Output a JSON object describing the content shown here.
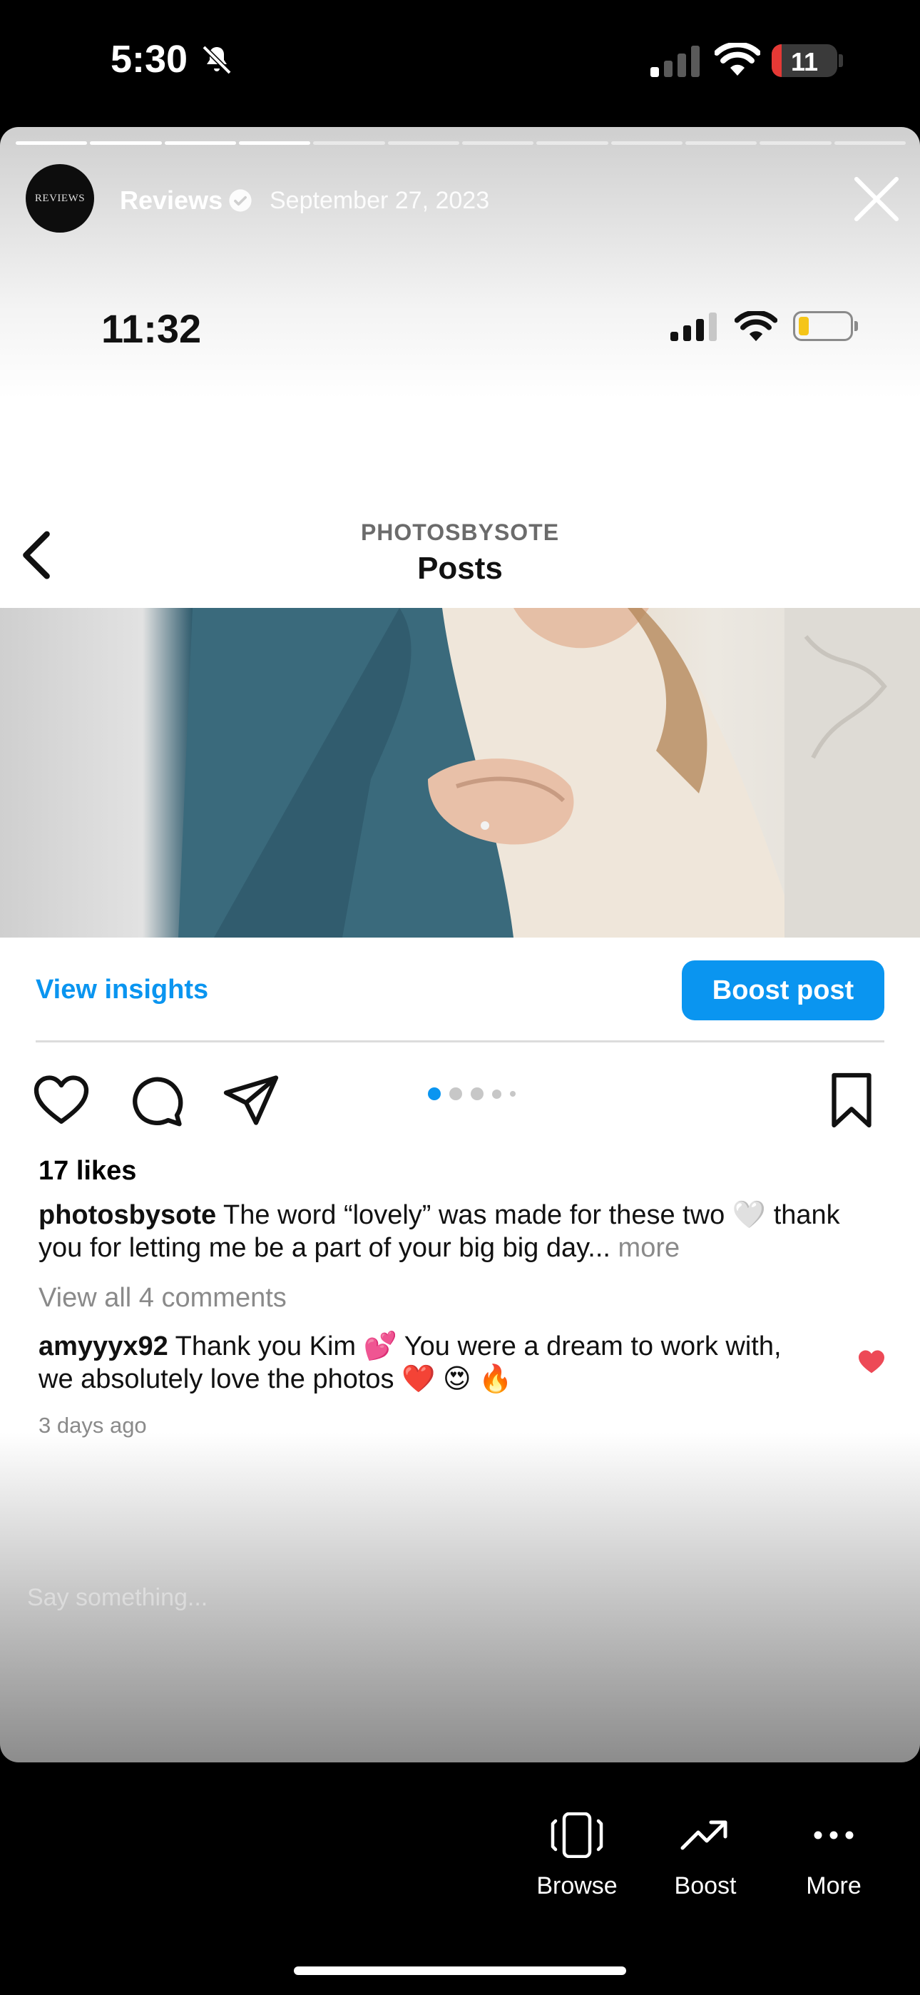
{
  "status_bar": {
    "time": "5:30",
    "battery": "11"
  },
  "story": {
    "account_name": "Reviews",
    "avatar_text": "REVIEWS",
    "date": "September 27, 2023",
    "progress_total": 12,
    "progress_done": 4
  },
  "inner": {
    "time": "11:32",
    "profile_name": "PHOTOSBYSOTE",
    "title": "Posts",
    "view_insights": "View insights",
    "boost_post": "Boost post",
    "likes": "17 likes",
    "caption_user": "photosbysote",
    "caption_text": "The word “lovely” was made for these two 🤍 thank you for letting me be a part of your big big day...",
    "caption_more": "more",
    "view_comments": "View all 4 comments",
    "comment_user": "amyyyx92",
    "comment_text": "Thank you Kim 💕 You were a dream to work with, we absolutely love the photos ❤️ 😍 🔥",
    "comment_time": "3 days ago",
    "carousel_active_index": 0
  },
  "reply_placeholder": "Say something...",
  "bottom_bar": {
    "browse": "Browse",
    "boost": "Boost",
    "more": "More"
  },
  "colors": {
    "accent": "#0a95f0",
    "heart": "#ed4956"
  },
  "icons": [
    "bell-slash-icon",
    "signal-icon",
    "wifi-icon",
    "battery-icon",
    "verified-icon",
    "close-icon",
    "back-icon",
    "heart-icon",
    "comment-icon",
    "share-icon",
    "bookmark-icon",
    "browse-icon",
    "boost-icon",
    "more-icon"
  ]
}
